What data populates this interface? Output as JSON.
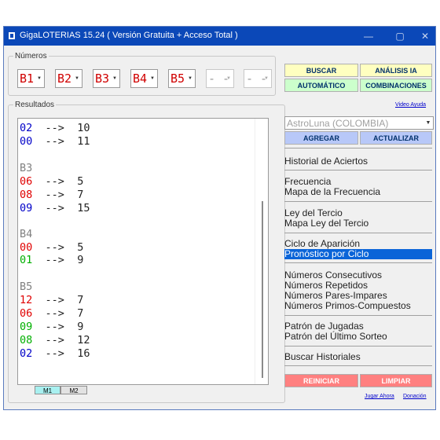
{
  "window": {
    "title": "GigaLOTERIAS 15.24  ( Versión Gratuita + Acceso Total )",
    "controls": {
      "minimize": "—",
      "maximize": "▢",
      "close": "✕"
    }
  },
  "numeros": {
    "legend": "Números",
    "selects": [
      "B1",
      "B2",
      "B3",
      "B4",
      "B5",
      "- -",
      "- -"
    ]
  },
  "resultados": {
    "legend": "Resultados",
    "lines": [
      {
        "num": "02",
        "arrow": "-->",
        "val": "10",
        "color": "blue"
      },
      {
        "num": "00",
        "arrow": "-->",
        "val": "11",
        "color": "blue"
      },
      {
        "num": "B3",
        "color": "gray"
      },
      {
        "num": "06",
        "arrow": "-->",
        "val": "5",
        "color": "red"
      },
      {
        "num": "08",
        "arrow": "-->",
        "val": "7",
        "color": "red"
      },
      {
        "num": "09",
        "arrow": "-->",
        "val": "15",
        "color": "blue"
      },
      {
        "num": "B4",
        "color": "gray"
      },
      {
        "num": "00",
        "arrow": "-->",
        "val": "5",
        "color": "red"
      },
      {
        "num": "01",
        "arrow": "-->",
        "val": "9",
        "color": "green"
      },
      {
        "num": "B5",
        "color": "gray"
      },
      {
        "num": "12",
        "arrow": "-->",
        "val": "7",
        "color": "red"
      },
      {
        "num": "06",
        "arrow": "-->",
        "val": "7",
        "color": "red"
      },
      {
        "num": "09",
        "arrow": "-->",
        "val": "9",
        "color": "green"
      },
      {
        "num": "08",
        "arrow": "-->",
        "val": "12",
        "color": "green"
      },
      {
        "num": "02",
        "arrow": "-->",
        "val": "16",
        "color": "blue"
      }
    ],
    "tabs": [
      "M1",
      "M2"
    ]
  },
  "buttons": {
    "buscar": "BUSCAR",
    "analisis": "ANÁLISIS IA",
    "automatico": "AUTOMÁTICO",
    "combinaciones": "COMBINACIONES",
    "agregar": "AGREGAR",
    "actualizar": "ACTUALIZAR",
    "reiniciar": "REINICIAR",
    "limpiar": "LIMPIAR"
  },
  "links": {
    "video_ayuda": "Video Ayuda",
    "jugar_ahora": "Jugar Ahora",
    "donacion": "Donación"
  },
  "lottery_select": {
    "value": "AstroLuna (COLOMBIA)"
  },
  "menu": {
    "historial_aciertos": "Historial de Aciertos",
    "frecuencia": "Frecuencia",
    "mapa_frecuencia": "Mapa de la Frecuencia",
    "ley_tercio": "Ley del Tercio",
    "mapa_ley_tercio": "Mapa Ley del Tercio",
    "ciclo_aparicion": "Ciclo de Aparición",
    "pronostico_ciclo": "Pronóstico por Ciclo",
    "numeros_consecutivos": "Números Consecutivos",
    "numeros_repetidos": "Números Repetidos",
    "numeros_pares_impares": "Números Pares-Impares",
    "numeros_primos_compuestos": "Números Primos-Compuestos",
    "patron_jugadas": "Patrón de Jugadas",
    "patron_ultimo_sorteo": "Patrón del Último Sorteo",
    "buscar_historiales": "Buscar Historiales"
  },
  "colors": {
    "titlebar": "#0b48b8",
    "selected_menu": "#0a64d8",
    "yellow_button": "#ffffc0",
    "green_button": "#ccffcc",
    "blue_button": "#b8c8f8",
    "red_button": "#ff8080"
  }
}
